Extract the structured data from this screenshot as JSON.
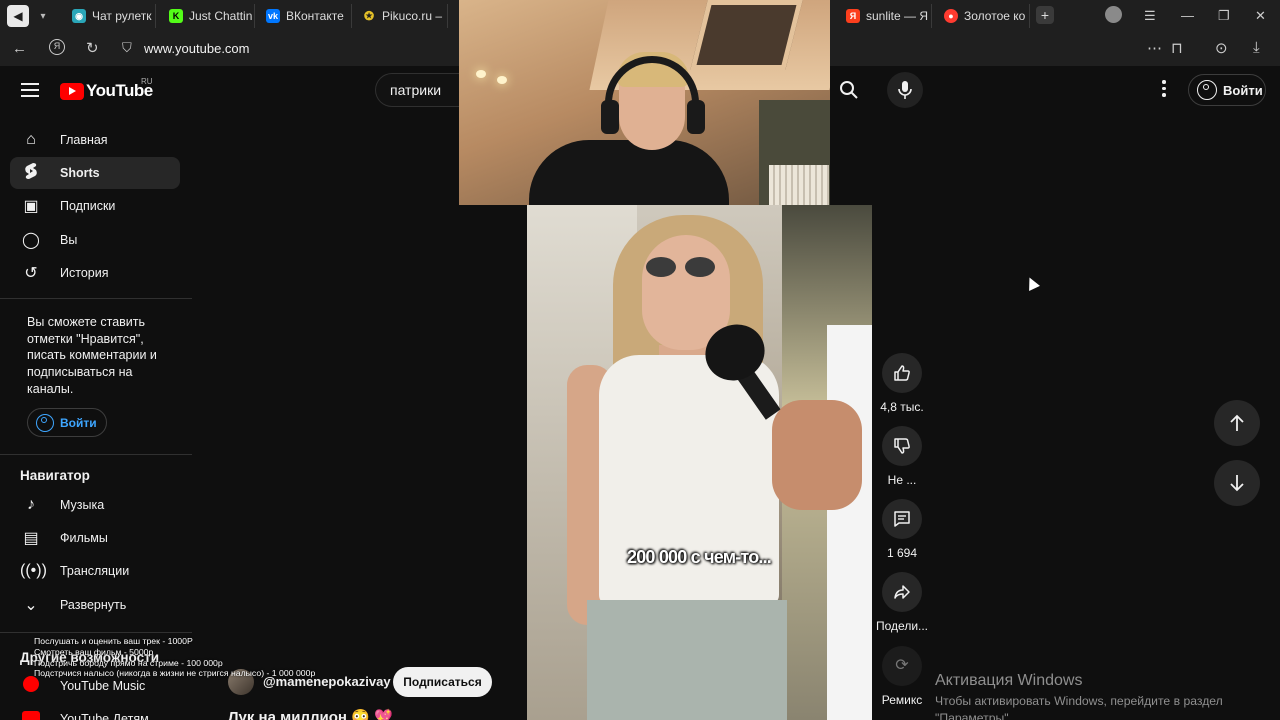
{
  "browser": {
    "tabs": [
      {
        "label": "Чат рулетк",
        "icon": "chat-roulette-icon",
        "color": "#2aa6b8"
      },
      {
        "label": "Just Chattin",
        "icon": "kick-icon",
        "color": "#53fc18"
      },
      {
        "label": "ВКонтакте",
        "icon": "vk-icon",
        "color": "#0077ff"
      },
      {
        "label": "Pikuco.ru –",
        "icon": "pikuco-icon",
        "color": "#e6c229"
      },
      {
        "label": "sunlite — Я",
        "icon": "yandex-icon",
        "color": "#fc3f1d"
      },
      {
        "label": "Золотое ко",
        "icon": "red-record-icon",
        "color": "#ff3b30"
      }
    ],
    "url": "www.youtube.com"
  },
  "header": {
    "logo_text": "YouTube",
    "region": "RU",
    "search_value": "патрики",
    "signin_label": "Войти"
  },
  "sidebar": {
    "items": [
      {
        "label": "Главная",
        "icon": "home-icon"
      },
      {
        "label": "Shorts",
        "icon": "shorts-icon",
        "active": true
      },
      {
        "label": "Подписки",
        "icon": "subscriptions-icon"
      },
      {
        "label": "Вы",
        "icon": "you-icon"
      },
      {
        "label": "История",
        "icon": "history-icon"
      }
    ],
    "promo_text": "Вы сможете ставить отметки \"Нравится\", писать комментарии и подписываться на каналы.",
    "signin_label": "Войти",
    "navigator_title": "Навигатор",
    "navigator_items": [
      {
        "label": "Музыка",
        "icon": "music-icon"
      },
      {
        "label": "Фильмы",
        "icon": "movies-icon"
      },
      {
        "label": "Трансляции",
        "icon": "live-icon"
      },
      {
        "label": "Развернуть",
        "icon": "expand-icon"
      }
    ],
    "other_title": "Другие возможности",
    "other_items": [
      {
        "label": "YouTube Music",
        "icon": "youtube-music-icon"
      },
      {
        "label": "YouTube Детям",
        "icon": "youtube-kids-icon"
      }
    ]
  },
  "short": {
    "caption": "200 000 с чем-то...",
    "channel": "@mamenepokazivay",
    "subscribe_label": "Подписаться",
    "title": "Лук на миллион 😳 💖"
  },
  "actions": {
    "like_count": "4,8 тыс.",
    "dislike_label": "Не ...",
    "comments_count": "1 694",
    "share_label": "Подели...",
    "remix_label": "Ремикс"
  },
  "overlay": {
    "donations": [
      "Послушать и оценить ваш трек - 1000Р",
      "Смотреть ваш фильм - 5000р",
      "Подстричь бороду прямо на стриме - 100 000р",
      "Подстрчися налысо (никогда в жизни не стригся налысо) - 1 000 000р"
    ],
    "windows_title": "Активация Windows",
    "windows_line1": "Чтобы активировать Windows, перейдите в раздел",
    "windows_line2": "\"Параметры\"."
  }
}
